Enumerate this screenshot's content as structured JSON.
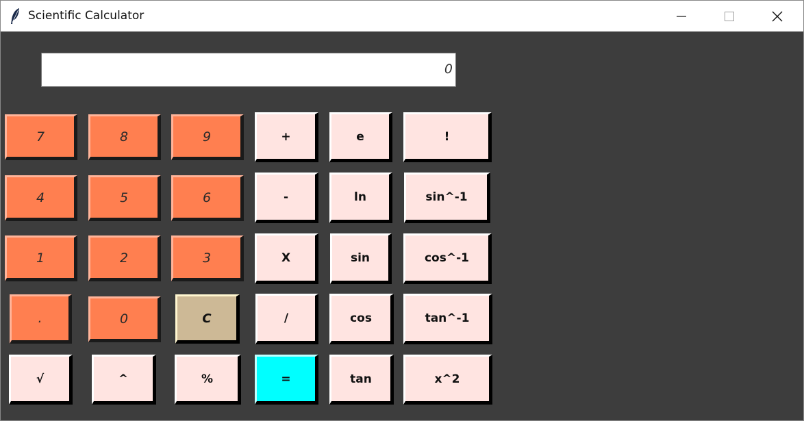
{
  "window": {
    "title": "Scientific Calculator",
    "controls": [
      "minimize-icon",
      "maximize-icon",
      "close-icon"
    ]
  },
  "display": {
    "value": "0"
  },
  "colors": {
    "number_button": "#ff7f50",
    "operator_button": "#ffe4e1",
    "clear_button": "#cdb996",
    "equals_button": "#00ffff",
    "background": "#3d3d3d"
  },
  "keys": {
    "n7": "7",
    "n8": "8",
    "n9": "9",
    "n4": "4",
    "n5": "5",
    "n6": "6",
    "n1": "1",
    "n2": "2",
    "n3": "3",
    "dot": ".",
    "n0": "0",
    "clear": "C",
    "sqrt": "√",
    "pow": "^",
    "percent": "%",
    "plus": "+",
    "minus": "-",
    "multiply": "X",
    "divide": "/",
    "equals": "=",
    "e": "e",
    "ln": "ln",
    "sin": "sin",
    "cos": "cos",
    "tan": "tan",
    "factorial": "!",
    "asin": "sin^-1",
    "acos": "cos^-1",
    "atan": "tan^-1",
    "square": "x^2"
  }
}
